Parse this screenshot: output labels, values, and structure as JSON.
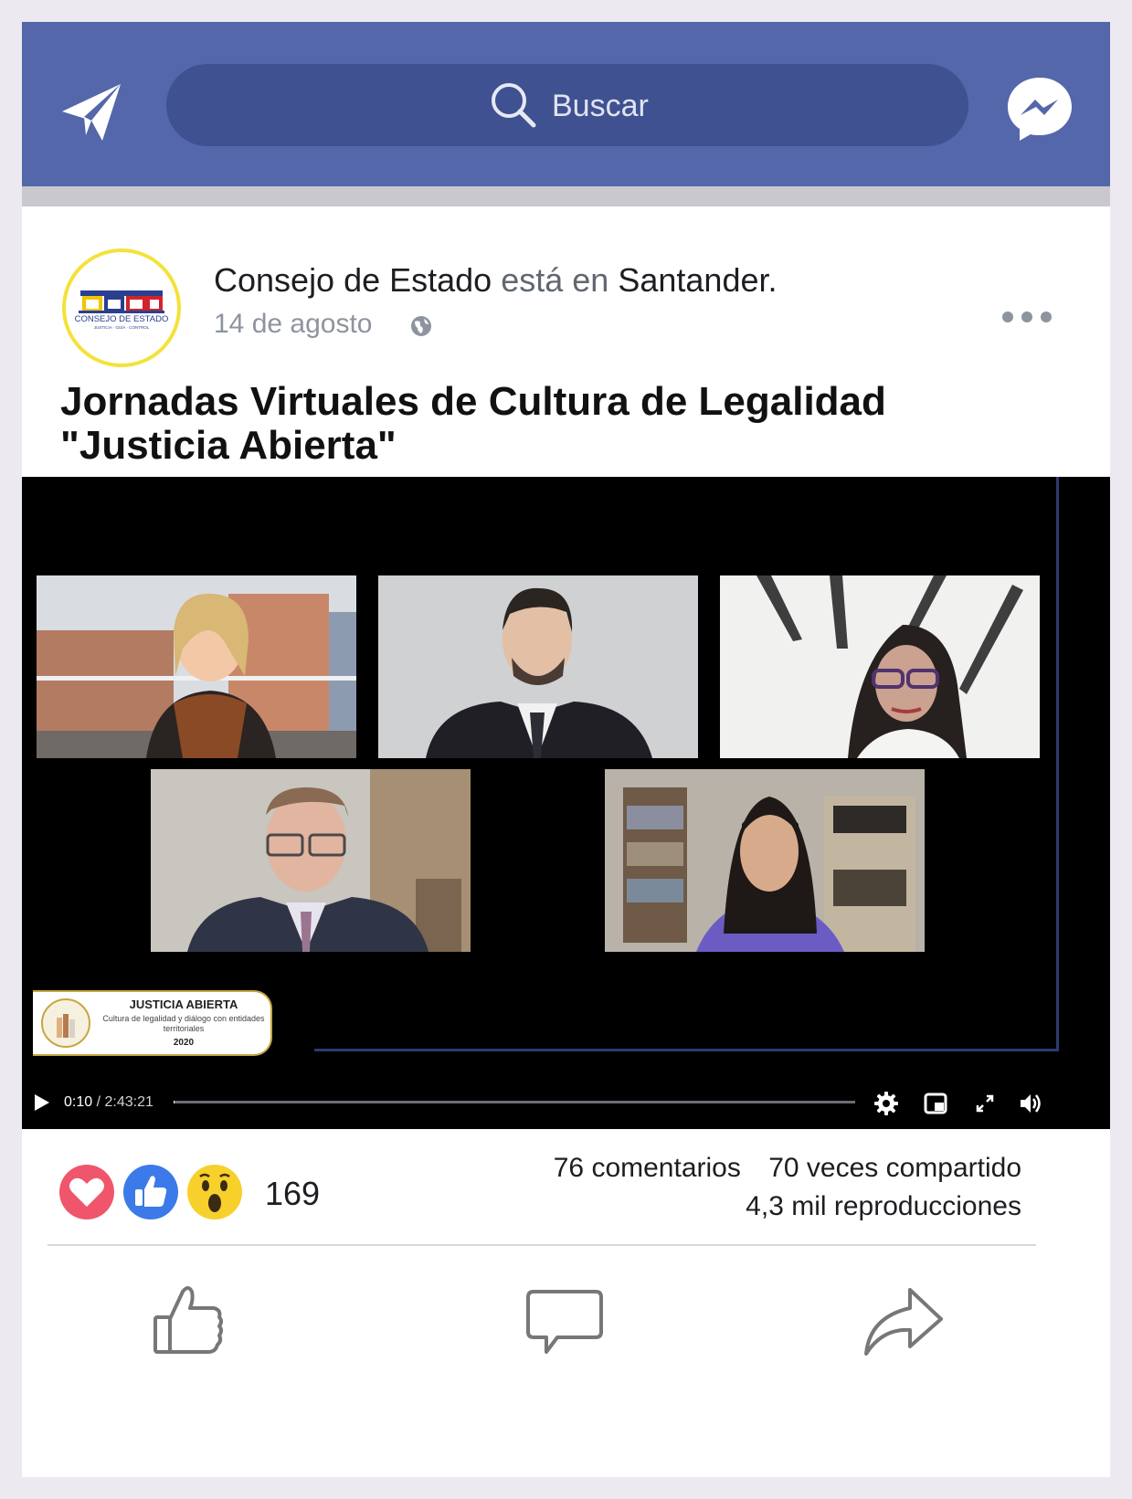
{
  "header": {
    "search_placeholder": "Buscar",
    "left_icon": "paper-plane-icon",
    "right_icon": "messenger-icon"
  },
  "post": {
    "author": "Consejo de Estado",
    "connector": "está en",
    "location": "Santander.",
    "date": "14 de agosto",
    "privacy_icon": "globe-icon",
    "title_line1": "Jornadas Virtuales de Cultura de Legalidad",
    "title_line2": "\"Justicia Abierta\""
  },
  "avatar_logo": {
    "name": "CONSEJO DE ESTADO",
    "tagline": "JUSTICIA · GUÍA · CONTROL"
  },
  "video": {
    "banner_title": "JUSTICIA ABIERTA",
    "banner_subtitle": "Cultura de legalidad y diálogo con entidades territoriales",
    "banner_year": "2020",
    "current_time": "0:10",
    "separator": " / ",
    "duration": "2:43:21",
    "progress_fraction": 0.001
  },
  "engagement": {
    "reaction_count": "169",
    "reactions": [
      "love",
      "like",
      "wow"
    ],
    "comments": "76 comentarios",
    "shares": "70 veces compartido",
    "views": "4,3 mil  reproducciones"
  },
  "colors": {
    "header_blue": "#5467ab",
    "search_blue": "#3f5190",
    "love_red": "#f0566b",
    "like_blue": "#3b7ae8",
    "wow_yellow": "#f7d02c",
    "avatar_ring": "#f4e23a"
  },
  "actions": [
    "thumbs-up-icon",
    "comment-icon",
    "share-icon"
  ]
}
